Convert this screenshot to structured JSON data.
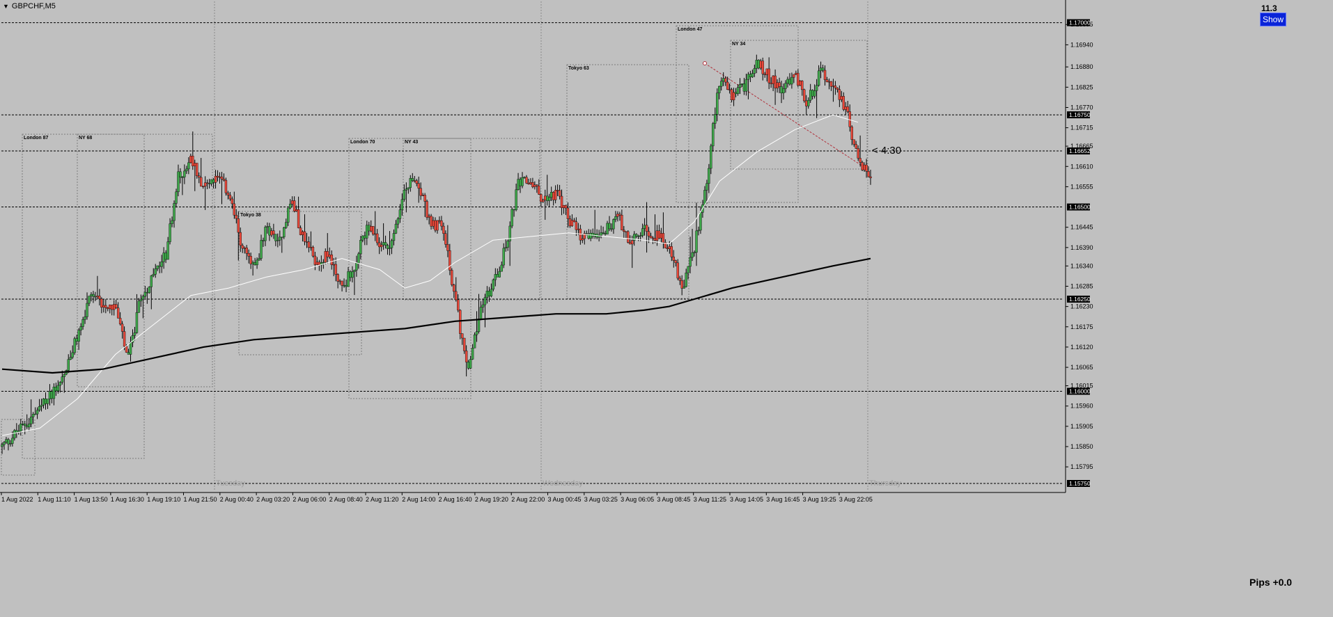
{
  "window": {
    "symbol_title": "GBPCHF,M5",
    "spread_value": "11.3",
    "show_button_label": "Show",
    "pips_label": "Pips +0.0",
    "countdown_label": "< 4:30"
  },
  "price_axis": {
    "labels": [
      "1.16995",
      "1.16940",
      "1.16880",
      "1.16825",
      "1.16770",
      "1.16715",
      "1.16665",
      "1.16610",
      "1.16555",
      "1.16445",
      "1.16390",
      "1.16340",
      "1.16285",
      "1.16230",
      "1.16175",
      "1.16120",
      "1.16065",
      "1.16015",
      "1.15960",
      "1.15905",
      "1.15850",
      "1.15795"
    ],
    "highlight_labels": [
      "1.17000",
      "1.16750",
      "1.16652",
      "1.16500",
      "1.16250",
      "1.16000",
      "1.15750"
    ]
  },
  "time_axis": {
    "labels": [
      "1 Aug 2022",
      "1 Aug 11:10",
      "1 Aug 13:50",
      "1 Aug 16:30",
      "1 Aug 19:10",
      "1 Aug 21:50",
      "2 Aug 00:40",
      "2 Aug 03:20",
      "2 Aug 06:00",
      "2 Aug 08:40",
      "2 Aug 11:20",
      "2 Aug 14:00",
      "2 Aug 16:40",
      "2 Aug 19:20",
      "2 Aug 22:00",
      "3 Aug 00:45",
      "3 Aug 03:25",
      "3 Aug 06:05",
      "3 Aug 08:45",
      "3 Aug 11:25",
      "3 Aug 14:05",
      "3 Aug 16:45",
      "3 Aug 19:25",
      "3 Aug 22:05"
    ],
    "day_labels": [
      "Tuesday",
      "Wednesday",
      "Thursday"
    ]
  },
  "sessions": {
    "labels": [
      "London 87",
      "NY 68",
      "Tokyo 38",
      "London 70",
      "NY 43",
      "Tokyo 63",
      "London 47",
      "NY 34"
    ]
  },
  "colors": {
    "background": "#c0c0c0",
    "bull": "#3ea84a",
    "bear": "#e8483a",
    "ma_slow": "#000000",
    "ma_fast": "#ffffff",
    "show_button": "#0a24d8"
  },
  "chart_data": {
    "type": "candlestick",
    "symbol": "GBPCHF",
    "timeframe": "M5",
    "ylim": [
      1.1575,
      1.1702
    ],
    "horizontal_levels": [
      1.17,
      1.1675,
      1.16652,
      1.165,
      1.1625,
      1.16
    ],
    "current_price": 1.16652,
    "price_path": [
      [
        0,
        1.1585
      ],
      [
        3,
        1.1595
      ],
      [
        5,
        1.1605
      ],
      [
        7,
        1.1625
      ],
      [
        9,
        1.1623
      ],
      [
        10,
        1.1608
      ],
      [
        11,
        1.1625
      ],
      [
        13,
        1.1637
      ],
      [
        14,
        1.1658
      ],
      [
        15,
        1.1663
      ],
      [
        16,
        1.1656
      ],
      [
        17,
        1.1658
      ],
      [
        18,
        1.1654
      ],
      [
        19,
        1.164
      ],
      [
        20,
        1.1633
      ],
      [
        21,
        1.1644
      ],
      [
        22,
        1.1641
      ],
      [
        23,
        1.1652
      ],
      [
        24,
        1.1641
      ],
      [
        25,
        1.1635
      ],
      [
        26,
        1.1637
      ],
      [
        27,
        1.1628
      ],
      [
        28,
        1.1634
      ],
      [
        29,
        1.1645
      ],
      [
        30,
        1.1639
      ],
      [
        31,
        1.1641
      ],
      [
        32,
        1.1655
      ],
      [
        33,
        1.1658
      ],
      [
        34,
        1.1645
      ],
      [
        35,
        1.1645
      ],
      [
        36,
        1.1625
      ],
      [
        37,
        1.1605
      ],
      [
        38,
        1.1622
      ],
      [
        39,
        1.1629
      ],
      [
        40,
        1.1639
      ],
      [
        41,
        1.1656
      ],
      [
        42,
        1.1657
      ],
      [
        43,
        1.1652
      ],
      [
        44,
        1.1654
      ],
      [
        45,
        1.1647
      ],
      [
        46,
        1.1641
      ],
      [
        47,
        1.1643
      ],
      [
        48,
        1.1644
      ],
      [
        49,
        1.1647
      ],
      [
        50,
        1.164
      ],
      [
        51,
        1.1644
      ],
      [
        52,
        1.1642
      ],
      [
        53,
        1.164
      ],
      [
        54,
        1.1627
      ],
      [
        55,
        1.1639
      ],
      [
        56,
        1.1658
      ],
      [
        57,
        1.1685
      ],
      [
        58,
        1.168
      ],
      [
        59,
        1.1683
      ],
      [
        60,
        1.1689
      ],
      [
        61,
        1.1685
      ],
      [
        62,
        1.1682
      ],
      [
        63,
        1.1686
      ],
      [
        64,
        1.1678
      ],
      [
        65,
        1.1687
      ],
      [
        66,
        1.1684
      ],
      [
        67,
        1.1677
      ],
      [
        68,
        1.1662
      ],
      [
        69,
        1.1658
      ]
    ],
    "moving_averages": [
      {
        "name": "fast",
        "path": [
          [
            0,
            1.1588
          ],
          [
            3,
            1.159
          ],
          [
            6,
            1.1598
          ],
          [
            9,
            1.161
          ],
          [
            12,
            1.1618
          ],
          [
            15,
            1.1626
          ],
          [
            18,
            1.1628
          ],
          [
            21,
            1.1631
          ],
          [
            24,
            1.1633
          ],
          [
            27,
            1.1636
          ],
          [
            30,
            1.1633
          ],
          [
            32,
            1.1628
          ],
          [
            34,
            1.163
          ],
          [
            36,
            1.1635
          ],
          [
            39,
            1.1641
          ],
          [
            42,
            1.1642
          ],
          [
            45,
            1.1643
          ],
          [
            48,
            1.1642
          ],
          [
            51,
            1.1641
          ],
          [
            53,
            1.164
          ],
          [
            55,
            1.1646
          ],
          [
            57,
            1.1657
          ],
          [
            60,
            1.1665
          ],
          [
            63,
            1.1671
          ],
          [
            66,
            1.1675
          ],
          [
            68,
            1.1673
          ]
        ]
      },
      {
        "name": "slow",
        "path": [
          [
            0,
            1.1606
          ],
          [
            4,
            1.1605
          ],
          [
            8,
            1.1606
          ],
          [
            12,
            1.1609
          ],
          [
            16,
            1.1612
          ],
          [
            20,
            1.1614
          ],
          [
            24,
            1.1615
          ],
          [
            28,
            1.1616
          ],
          [
            32,
            1.1617
          ],
          [
            36,
            1.1619
          ],
          [
            40,
            1.162
          ],
          [
            44,
            1.1621
          ],
          [
            48,
            1.1621
          ],
          [
            51,
            1.1622
          ],
          [
            53,
            1.1623
          ],
          [
            55,
            1.1625
          ],
          [
            58,
            1.1628
          ],
          [
            62,
            1.1631
          ],
          [
            66,
            1.1634
          ],
          [
            69,
            1.1636
          ]
        ]
      }
    ]
  }
}
